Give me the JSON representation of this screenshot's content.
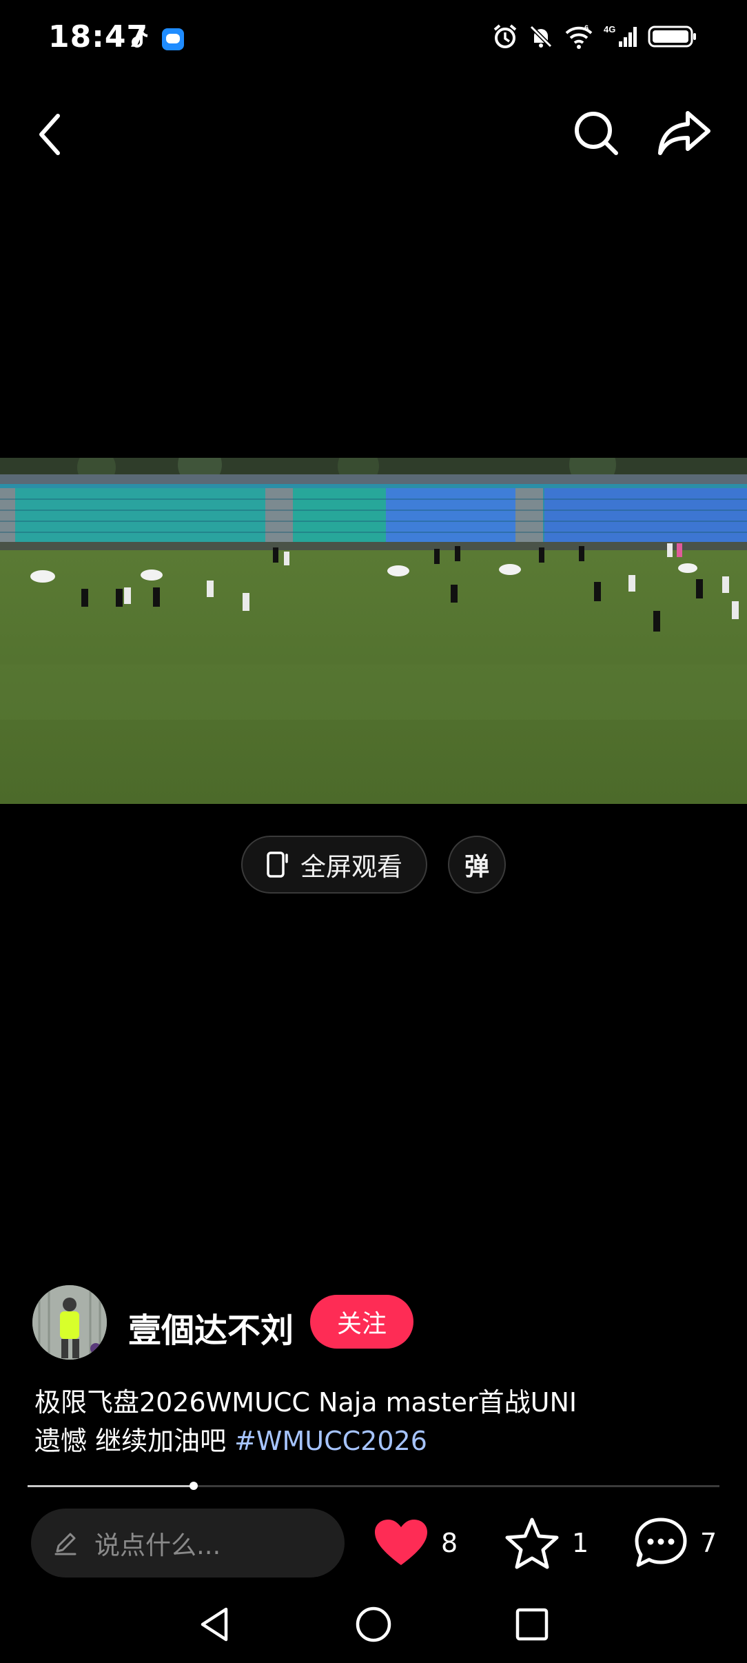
{
  "status_bar": {
    "time": "18:47",
    "app_icons": [
      "tiktok-icon",
      "message-bubble-icon"
    ],
    "right_icons": [
      "alarm-icon",
      "mute-bell-icon",
      "wifi-icon",
      "signal-4g-icon",
      "battery-icon"
    ],
    "wifi_badge": "6",
    "network_label": "4G"
  },
  "nav": {
    "icons": [
      "back-icon",
      "search-icon",
      "share-icon"
    ]
  },
  "video": {
    "progress_fraction": 0.24
  },
  "player_controls": {
    "fullscreen_label": "全屏观看",
    "danmaku_label": "弹"
  },
  "author": {
    "name": "壹個达不刘",
    "follow_label": "关注"
  },
  "caption": {
    "line1": "极限飞盘2026WMUCC Naja master首战UNI",
    "line2": "遗憾 继续加油吧",
    "hashtag": "#WMUCC2026"
  },
  "comment_input": {
    "placeholder": "说点什么..."
  },
  "actions": {
    "likes": "8",
    "favorites": "1",
    "comments": "7",
    "like_color": "#fe2c55"
  },
  "system_nav": [
    "back-triangle-icon",
    "home-circle-icon",
    "recents-square-icon"
  ]
}
